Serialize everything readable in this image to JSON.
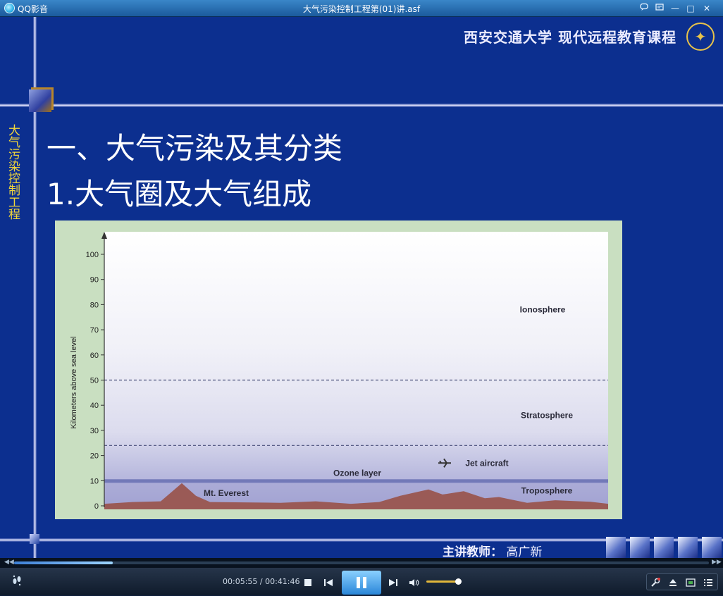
{
  "titlebar": {
    "app_name": "QQ影音",
    "window_title": "大气污染控制工程第(01)讲.asf",
    "buttons": {
      "chat_icon": "chat-icon",
      "skin_icon": "skin-icon",
      "minimize": "—",
      "maximize": "□",
      "close": "✕"
    }
  },
  "slide": {
    "header": "西安交通大学  现代远程教育课程",
    "side_title": "大气污染控制工程",
    "heading1": "一、大气污染及其分类",
    "heading2": "1.大气圈及大气组成",
    "lecturer_label": "主讲教师：",
    "lecturer_name": "高广新"
  },
  "chart_data": {
    "type": "area",
    "ylabel": "Kilometers above sea level",
    "yticks": [
      0,
      10,
      20,
      30,
      40,
      50,
      60,
      70,
      80,
      90,
      100
    ],
    "ylim": [
      0,
      100
    ],
    "boundaries_km": [
      50,
      24,
      10
    ],
    "annotations": [
      {
        "text": "Ionosphere",
        "y": 78
      },
      {
        "text": "Stratosphere",
        "y": 36
      },
      {
        "text": "Jet aircraft",
        "y": 17
      },
      {
        "text": "Ozone layer",
        "y": 13
      },
      {
        "text": "Troposphere",
        "y": 6
      },
      {
        "text": "Mt. Everest",
        "y": 5
      }
    ],
    "colors": {
      "sky_top": "#f5f5fb",
      "sky_low": "#a6a7d4",
      "ozone": "#7279b8",
      "terrain": "#9a5a56"
    }
  },
  "player": {
    "current_time": "00:05:55",
    "total_time": "00:41:46",
    "progress": 0.142,
    "volume": 0.9,
    "buttons": [
      "stop",
      "previous",
      "pause",
      "next",
      "volume",
      "settings",
      "eject",
      "screenshot",
      "playlist"
    ]
  }
}
